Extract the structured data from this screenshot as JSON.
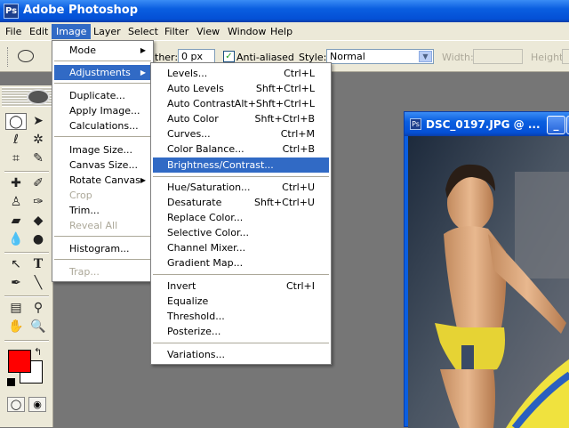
{
  "app": {
    "title": "Adobe Photoshop",
    "icon_letters": "Ps"
  },
  "menubar": {
    "items": [
      "File",
      "Edit",
      "Image",
      "Layer",
      "Select",
      "Filter",
      "View",
      "Window",
      "Help"
    ],
    "active": "Image"
  },
  "options": {
    "feather_label": "ther:",
    "feather_value": "0 px",
    "antialiased_label": "Anti-aliased",
    "style_label": "Style:",
    "style_value": "Normal",
    "width_label": "Width:",
    "height_label": "Height:"
  },
  "image_menu": {
    "items": [
      {
        "label": "Mode",
        "submenu": true
      },
      {
        "label": "Adjustments",
        "submenu": true,
        "highlighted": true
      },
      {
        "label": "Duplicate..."
      },
      {
        "label": "Apply Image..."
      },
      {
        "label": "Calculations..."
      },
      {
        "label": "Image Size..."
      },
      {
        "label": "Canvas Size..."
      },
      {
        "label": "Rotate Canvas",
        "submenu": true
      },
      {
        "label": "Crop",
        "disabled": true
      },
      {
        "label": "Trim..."
      },
      {
        "label": "Reveal All",
        "disabled": true
      },
      {
        "label": "Histogram..."
      },
      {
        "label": "Trap...",
        "disabled": true
      }
    ]
  },
  "adjustments_menu": {
    "items": [
      {
        "label": "Levels...",
        "shortcut": "Ctrl+L"
      },
      {
        "label": "Auto Levels",
        "shortcut": "Shft+Ctrl+L"
      },
      {
        "label": "Auto Contrast",
        "shortcut": "Alt+Shft+Ctrl+L"
      },
      {
        "label": "Auto Color",
        "shortcut": "Shft+Ctrl+B"
      },
      {
        "label": "Curves...",
        "shortcut": "Ctrl+M"
      },
      {
        "label": "Color Balance...",
        "shortcut": "Ctrl+B"
      },
      {
        "label": "Brightness/Contrast...",
        "shortcut": "",
        "highlighted": true
      },
      {
        "label": "Hue/Saturation...",
        "shortcut": "Ctrl+U"
      },
      {
        "label": "Desaturate",
        "shortcut": "Shft+Ctrl+U"
      },
      {
        "label": "Replace Color...",
        "shortcut": ""
      },
      {
        "label": "Selective Color...",
        "shortcut": ""
      },
      {
        "label": "Channel Mixer...",
        "shortcut": ""
      },
      {
        "label": "Gradient Map...",
        "shortcut": ""
      },
      {
        "label": "Invert",
        "shortcut": "Ctrl+I"
      },
      {
        "label": "Equalize",
        "shortcut": ""
      },
      {
        "label": "Threshold...",
        "shortcut": ""
      },
      {
        "label": "Posterize...",
        "shortcut": ""
      },
      {
        "label": "Variations...",
        "shortcut": ""
      }
    ]
  },
  "document": {
    "title": "DSC_0197.JPG @ ..."
  },
  "colors": {
    "foreground": "#ff0000",
    "background": "#ffffff",
    "highlight": "#316ac5",
    "titlebar": "#0a5ee0"
  },
  "tools": [
    "marquee-icon",
    "move-icon",
    "lasso-icon",
    "magic-wand-icon",
    "crop-icon",
    "slice-icon",
    "healing-brush-icon",
    "brush-icon",
    "clone-stamp-icon",
    "history-brush-icon",
    "eraser-icon",
    "paint-bucket-icon",
    "blur-icon",
    "dodge-icon",
    "path-selection-icon",
    "type-icon",
    "pen-icon",
    "line-icon",
    "notes-icon",
    "eyedropper-icon",
    "hand-icon",
    "zoom-icon"
  ]
}
